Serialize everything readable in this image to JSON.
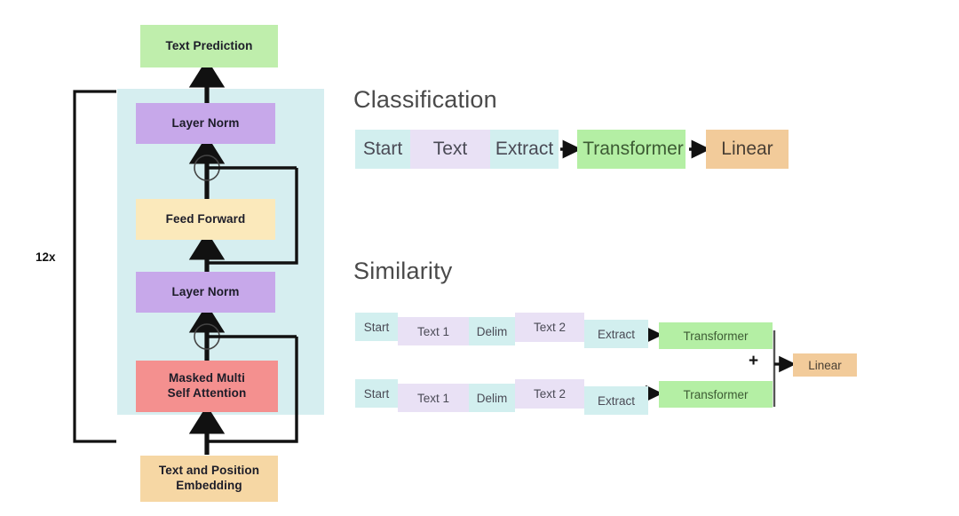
{
  "diagram": {
    "title_hidden": "GPT architecture and task-specific input transformations",
    "left_panel": {
      "repeat_label": "12x",
      "blocks": [
        {
          "id": "text-prediction",
          "label": "Text Prediction",
          "color": "#bfeeac"
        },
        {
          "id": "layer-norm-2",
          "label": "Layer Norm",
          "color": "#c7a8ea"
        },
        {
          "id": "feed-forward",
          "label": "Feed Forward",
          "color": "#fbe9bb"
        },
        {
          "id": "layer-norm-1",
          "label": "Layer Norm",
          "color": "#c7a8ea"
        },
        {
          "id": "masked-attention",
          "label": "Masked Multi\nSelf Attention",
          "color": "#f4908f"
        },
        {
          "id": "text-position-embedding",
          "label": "Text and Position\nEmbedding",
          "color": "#f6d7a4"
        }
      ],
      "masked_attention_line1": "Masked Multi",
      "masked_attention_line2": "Self Attention",
      "embedding_line1": "Text and Position",
      "embedding_line2": "Embedding",
      "container_color": "#d6eef0"
    },
    "classification": {
      "title": "Classification",
      "tokens": [
        {
          "label": "Start",
          "color": "#d2efef"
        },
        {
          "label": "Text",
          "color": "#e9e1f5"
        },
        {
          "label": "Extract",
          "color": "#d2efef"
        }
      ],
      "transformer": "Transformer",
      "transformer_color": "#b4efa4",
      "output": "Linear",
      "output_color": "#f2cb9a"
    },
    "similarity": {
      "title": "Similarity",
      "rows": [
        {
          "tokens": [
            {
              "label": "Start",
              "color": "#d2efef"
            },
            {
              "label": "Text 1",
              "color": "#e9e1f5"
            },
            {
              "label": "Delim",
              "color": "#d2efef"
            },
            {
              "label": "Text 2",
              "color": "#e9e1f5"
            },
            {
              "label": "Extract",
              "color": "#d2efef"
            }
          ],
          "transformer": "Transformer"
        },
        {
          "tokens": [
            {
              "label": "Start",
              "color": "#d2efef"
            },
            {
              "label": "Text 1",
              "color": "#e9e1f5"
            },
            {
              "label": "Delim",
              "color": "#d2efef"
            },
            {
              "label": "Text 2",
              "color": "#e9e1f5"
            },
            {
              "label": "Extract",
              "color": "#d2efef"
            }
          ],
          "transformer": "Transformer"
        }
      ],
      "merge_symbol": "+",
      "output": "Linear",
      "output_color": "#f2cb9a",
      "transformer_color": "#b4efa4"
    },
    "colors": {
      "background": "#ffffff",
      "arrow": "#111111",
      "teal": "#d2efef",
      "lilac": "#e9e1f5",
      "green": "#b4efa4",
      "peach": "#f2cb9a",
      "purple": "#c7a8ea",
      "red": "#f4908f",
      "yellow": "#fbe9bb",
      "container": "#d6eef0"
    }
  }
}
